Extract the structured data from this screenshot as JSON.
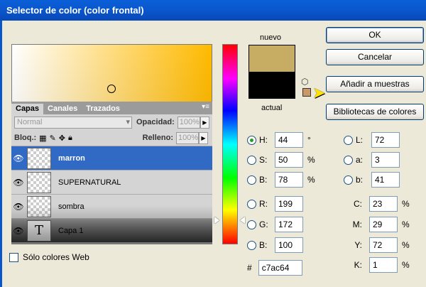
{
  "window": {
    "title": "Selector de color (color frontal)"
  },
  "buttons": {
    "ok": "OK",
    "cancel": "Cancelar",
    "add_swatches": "Añadir a muestras",
    "libraries": "Bibliotecas de colores"
  },
  "swatch": {
    "new_label": "nuevo",
    "current_label": "actual",
    "new_color": "#c7ac64",
    "current_color": "#000000",
    "web_safe_color": "#cc9966"
  },
  "hsb": [
    {
      "name": "H:",
      "value": "44",
      "unit": "°",
      "selected": true
    },
    {
      "name": "S:",
      "value": "50",
      "unit": "%",
      "selected": false
    },
    {
      "name": "B:",
      "value": "78",
      "unit": "%",
      "selected": false
    }
  ],
  "rgb": [
    {
      "name": "R:",
      "value": "199"
    },
    {
      "name": "G:",
      "value": "172"
    },
    {
      "name": "B:",
      "value": "100"
    }
  ],
  "lab": [
    {
      "name": "L:",
      "value": "72"
    },
    {
      "name": "a:",
      "value": "3"
    },
    {
      "name": "b:",
      "value": "41"
    }
  ],
  "cmyk": [
    {
      "name": "C:",
      "value": "23",
      "unit": "%"
    },
    {
      "name": "M:",
      "value": "29",
      "unit": "%"
    },
    {
      "name": "Y:",
      "value": "72",
      "unit": "%"
    },
    {
      "name": "K:",
      "value": "1",
      "unit": "%"
    }
  ],
  "hex": {
    "label": "#",
    "value": "c7ac64"
  },
  "web_only": {
    "label": "Sólo colores Web",
    "checked": false
  },
  "layers_panel": {
    "tabs": [
      "Capas",
      "Canales",
      "Trazados"
    ],
    "blend_mode": "Normal",
    "opacity_label": "Opacidad:",
    "opacity_value": "100%",
    "lock_label": "Bloq.:",
    "fill_label": "Relleno:",
    "fill_value": "100%",
    "layers": [
      {
        "name": "marron",
        "selected": true
      },
      {
        "name": "SUPERNATURAL",
        "selected": false
      },
      {
        "name": "sombra",
        "selected": false
      },
      {
        "name": "Capa 1",
        "selected": false
      }
    ]
  },
  "icons": {
    "eye": "eye-icon",
    "cube": "cube-icon",
    "cursor": "cursor-arrow-icon",
    "text_layer": "T"
  }
}
